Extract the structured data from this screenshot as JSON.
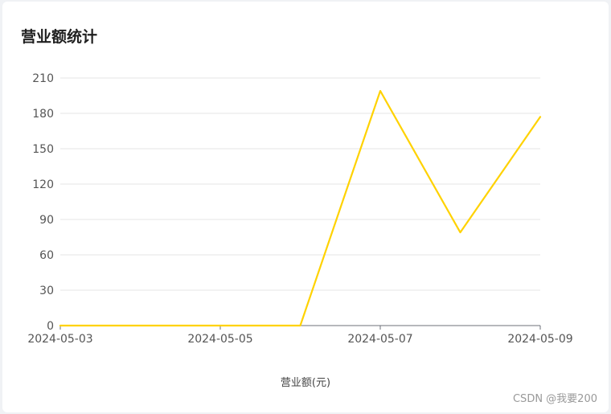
{
  "page": {
    "title": "营业额统计",
    "watermark": "CSDN @我要200"
  },
  "chart_data": {
    "type": "line",
    "title": "营业额统计",
    "x": [
      "2024-05-03",
      "2024-05-04",
      "2024-05-05",
      "2024-05-06",
      "2024-05-07",
      "2024-05-08",
      "2024-05-09"
    ],
    "x_tick_labels": [
      "2024-05-03",
      "2024-05-05",
      "2024-05-07",
      "2024-05-09"
    ],
    "series": [
      {
        "name": "营业额(元)",
        "color": "#ffd200",
        "values": [
          0,
          0,
          0,
          0,
          199,
          79,
          177
        ]
      }
    ],
    "ylim": [
      0,
      210
    ],
    "yticks": [
      0,
      30,
      60,
      90,
      120,
      150,
      180,
      210
    ],
    "grid": true,
    "legend_position": "bottom-center"
  }
}
